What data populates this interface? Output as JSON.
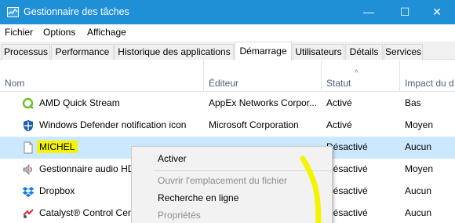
{
  "window": {
    "title": "Gestionnaire des tâches",
    "controls": {
      "minimize": "—",
      "maximize": "☐",
      "close": "✕"
    }
  },
  "menu": [
    "Fichier",
    "Options",
    "Affichage"
  ],
  "tabs": [
    "Processus",
    "Performance",
    "Historique des applications",
    "Démarrage",
    "Utilisateurs",
    "Détails",
    "Services"
  ],
  "active_tab": "Démarrage",
  "columns": {
    "name": "Nom",
    "publisher": "Éditeur",
    "status": "Statut",
    "impact": "Impact du d"
  },
  "rows": [
    {
      "name": "AMD Quick Stream",
      "publisher": "AppEx Networks Corpor...",
      "status": "Activé",
      "impact": "Bas",
      "icon": "amd-quick-stream-icon"
    },
    {
      "name": "Windows Defender notification icon",
      "publisher": "Microsoft Corporation",
      "status": "Activé",
      "impact": "Moyen",
      "icon": "windows-defender-icon"
    },
    {
      "name": "MICHEL",
      "publisher": "",
      "status": "Désactivé",
      "impact": "Aucun",
      "icon": "blank-file-icon",
      "selected": true
    },
    {
      "name": "Gestionnaire audio HD",
      "publisher": "",
      "status": "Désactivé",
      "impact": "Moyen",
      "icon": "speaker-icon"
    },
    {
      "name": "Dropbox",
      "publisher": "",
      "status": "Désactivé",
      "impact": "Aucun",
      "icon": "dropbox-icon"
    },
    {
      "name": "Catalyst® Control Cer",
      "publisher": "",
      "status": "Désactivé",
      "impact": "Aucun",
      "icon": "catalyst-icon"
    }
  ],
  "context_menu": [
    {
      "label": "Activer",
      "enabled": true
    },
    {
      "label": "Ouvrir l'emplacement du fichier",
      "enabled": false
    },
    {
      "label": "Recherche en ligne",
      "enabled": true
    },
    {
      "label": "Propriétés",
      "enabled": false
    }
  ],
  "colors": {
    "titlebar": "#1f8fd6",
    "selection": "#cce8ff",
    "highlight": "#f4f400"
  }
}
